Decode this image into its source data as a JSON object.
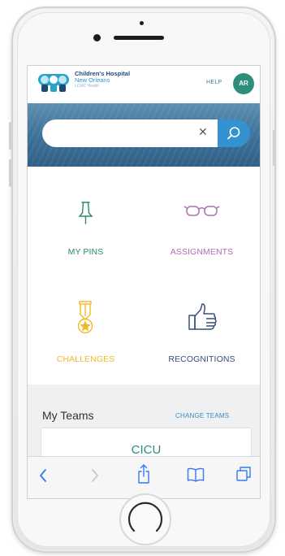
{
  "header": {
    "logo_line1": "Children's Hospital",
    "logo_line2": "New Orleans",
    "logo_line3": "LCMC Health",
    "help": "HELP",
    "avatar_initials": "AR"
  },
  "search": {
    "placeholder": "",
    "clear_icon": "close-icon",
    "button_icon": "search-icon"
  },
  "tiles": [
    {
      "label": "MY PINS",
      "icon": "pin-icon",
      "color": "#2a8a6e"
    },
    {
      "label": "ASSIGNMENTS",
      "icon": "glasses-icon",
      "color": "#b06fb0"
    },
    {
      "label": "CHALLENGES",
      "icon": "medal-icon",
      "color": "#f2b92a"
    },
    {
      "label": "RECOGNITIONS",
      "icon": "thumbs-up-icon",
      "color": "#3b4f7a"
    }
  ],
  "teams": {
    "title": "My Teams",
    "change_label": "CHANGE TEAMS",
    "items": [
      "CICU"
    ]
  },
  "browser_toolbar": {
    "icons": [
      "back-icon",
      "forward-icon",
      "share-icon",
      "bookmarks-icon",
      "tabs-icon"
    ],
    "accent": "#3478f6"
  }
}
